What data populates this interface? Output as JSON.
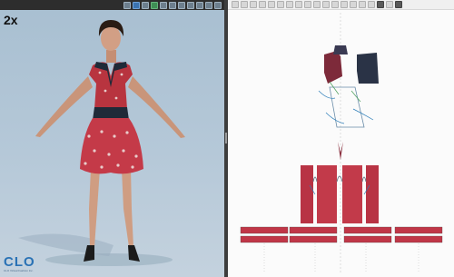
{
  "app": {
    "name": "CLO",
    "logo_text": "CLO",
    "logo_subtext": "CLO Virtual Fashion Inc."
  },
  "viewport3d": {
    "speed_label": "2x",
    "background_color": "#b5c8d8",
    "avatar": {
      "pose": "A-pose",
      "garment": "floral print dress",
      "garment_colors": [
        "#c43a48",
        "#1f2a38",
        "#e8e4e0"
      ]
    },
    "toolbar_icons": [
      "hand-icon",
      "select-icon",
      "view-icon",
      "display-icon",
      "pin-icon",
      "avatar-icon",
      "fabric-icon",
      "render-icon",
      "record-icon",
      "sim-icon",
      "settings-icon"
    ]
  },
  "viewport2d": {
    "background_color": "#fbfbfb",
    "toolbar_icons": [
      "select-icon",
      "transform-icon",
      "edit-point-icon",
      "curve-icon",
      "rect-icon",
      "polygon-icon",
      "circle-icon",
      "internal-line-icon",
      "dart-icon",
      "notch-icon",
      "seam-icon",
      "segment-icon",
      "free-seam-icon",
      "topstitch-icon",
      "text-icon",
      "grid-icon",
      "layout-icon",
      "view-icon",
      "settings-icon"
    ],
    "pattern_pieces": [
      "bodice-front",
      "bodice-back",
      "collar",
      "skirt-front",
      "skirt-back",
      "waistband",
      "hem-band-1",
      "hem-band-2",
      "hem-band-3",
      "hem-band-4"
    ]
  }
}
